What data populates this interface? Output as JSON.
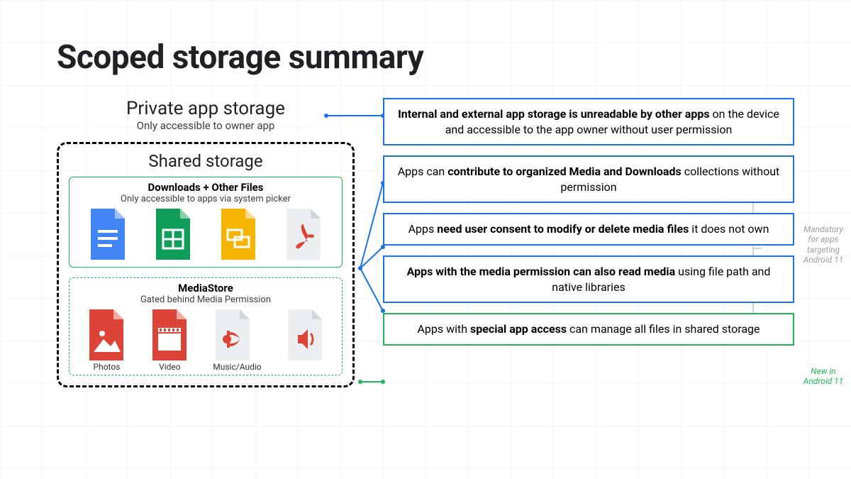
{
  "title": "Scoped storage summary",
  "private": {
    "heading": "Private app storage",
    "subtitle": "Only accessible to owner app"
  },
  "shared": {
    "heading": "Shared storage",
    "downloads": {
      "title": "Downloads + Other Files",
      "subtitle": "Only accessible to apps via system picker"
    },
    "mediastore": {
      "title": "MediaStore",
      "subtitle": "Gated behind Media Permission",
      "labels": {
        "photos": "Photos",
        "video": "Video",
        "music": "Music/Audio"
      }
    }
  },
  "info": {
    "box1_a": "Internal and external app storage is unreadable by other apps",
    "box1_b": " on the device and accessible to the app owner without user permission",
    "box2_a": "Apps can ",
    "box2_b": "contribute to organized Media and Downloads",
    "box2_c": " collections without permission",
    "box3_a": "Apps ",
    "box3_b": "need user consent to modify or delete media files",
    "box3_c": " it does not own",
    "box4_a": "Apps with the media permission can also read media",
    "box4_b": " using file path and native libraries",
    "box5_a": "Apps with ",
    "box5_b": "special app access",
    "box5_c": " can manage all files in shared storage"
  },
  "notes": {
    "mandatory": "Mandatory for apps targeting Android 11",
    "new": "New in Android 11"
  },
  "colors": {
    "blue": "#1a73e8",
    "green": "#1db954"
  }
}
